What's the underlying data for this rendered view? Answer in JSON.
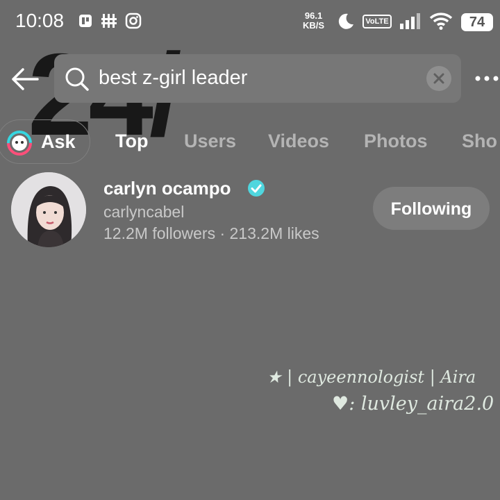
{
  "status_bar": {
    "time": "10:08",
    "net_speed_value": "96.1",
    "net_speed_unit": "KB/S",
    "volte": "VoLTE",
    "battery": "74",
    "icons": [
      "pdf-app-icon",
      "network-app-icon",
      "instagram-icon",
      "moon-icon",
      "signal-icon",
      "wifi-icon",
      "battery-icon"
    ]
  },
  "watermark": "24/",
  "search": {
    "query": "best z-girl leader",
    "icons": [
      "back-arrow-icon",
      "search-icon",
      "clear-icon",
      "more-icon"
    ]
  },
  "tabs": {
    "ask": "Ask",
    "items": [
      "Top",
      "Users",
      "Videos",
      "Photos",
      "Sho"
    ],
    "active": "Top"
  },
  "result": {
    "display_name": "carlyn ocampo",
    "username": "carlyncabel",
    "stats": "12.2M followers · 213.2M likes",
    "follow_label": "Following",
    "verified": true
  },
  "credits": {
    "line1": "★ | cayeennologist | Aira",
    "line2": "♥: luvley_aira2.0"
  },
  "colors": {
    "background": "#6b6b6b",
    "verified": "#4fd6de",
    "credit_text": "#dfe9e0"
  }
}
